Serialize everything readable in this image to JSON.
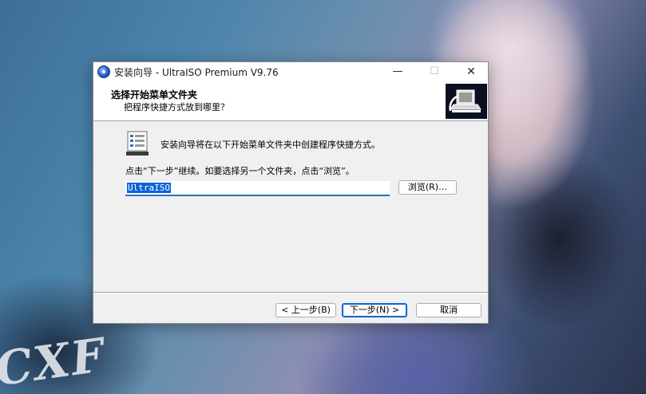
{
  "window": {
    "title": "安装向导 - UltraISO Premium V9.76",
    "minimize_glyph": "—",
    "maximize_glyph": "☐",
    "close_glyph": "✕"
  },
  "header": {
    "title": "选择开始菜单文件夹",
    "subtitle": "把程序快捷方式放到哪里？"
  },
  "content": {
    "intro": "安装向导将在以下开始菜单文件夹中创建程序快捷方式。",
    "continue_hint": "点击“下一步”继续。如要选择另一个文件夹，点击“浏览”。",
    "folder_value": "UltraISO",
    "browse_label": "浏览(R)…"
  },
  "footer": {
    "back_label": "< 上一步(B)",
    "next_label": "下一步(N) >",
    "cancel_label": "取消"
  },
  "icons": {
    "app": "ultraiso-disc-icon",
    "menu_folder": "start-menu-folder-icon",
    "header_image": "installer-computer-icon"
  },
  "colors": {
    "accent": "#0a64d8",
    "window_bg": "#f0f0f0",
    "header_bg": "#ffffff"
  }
}
